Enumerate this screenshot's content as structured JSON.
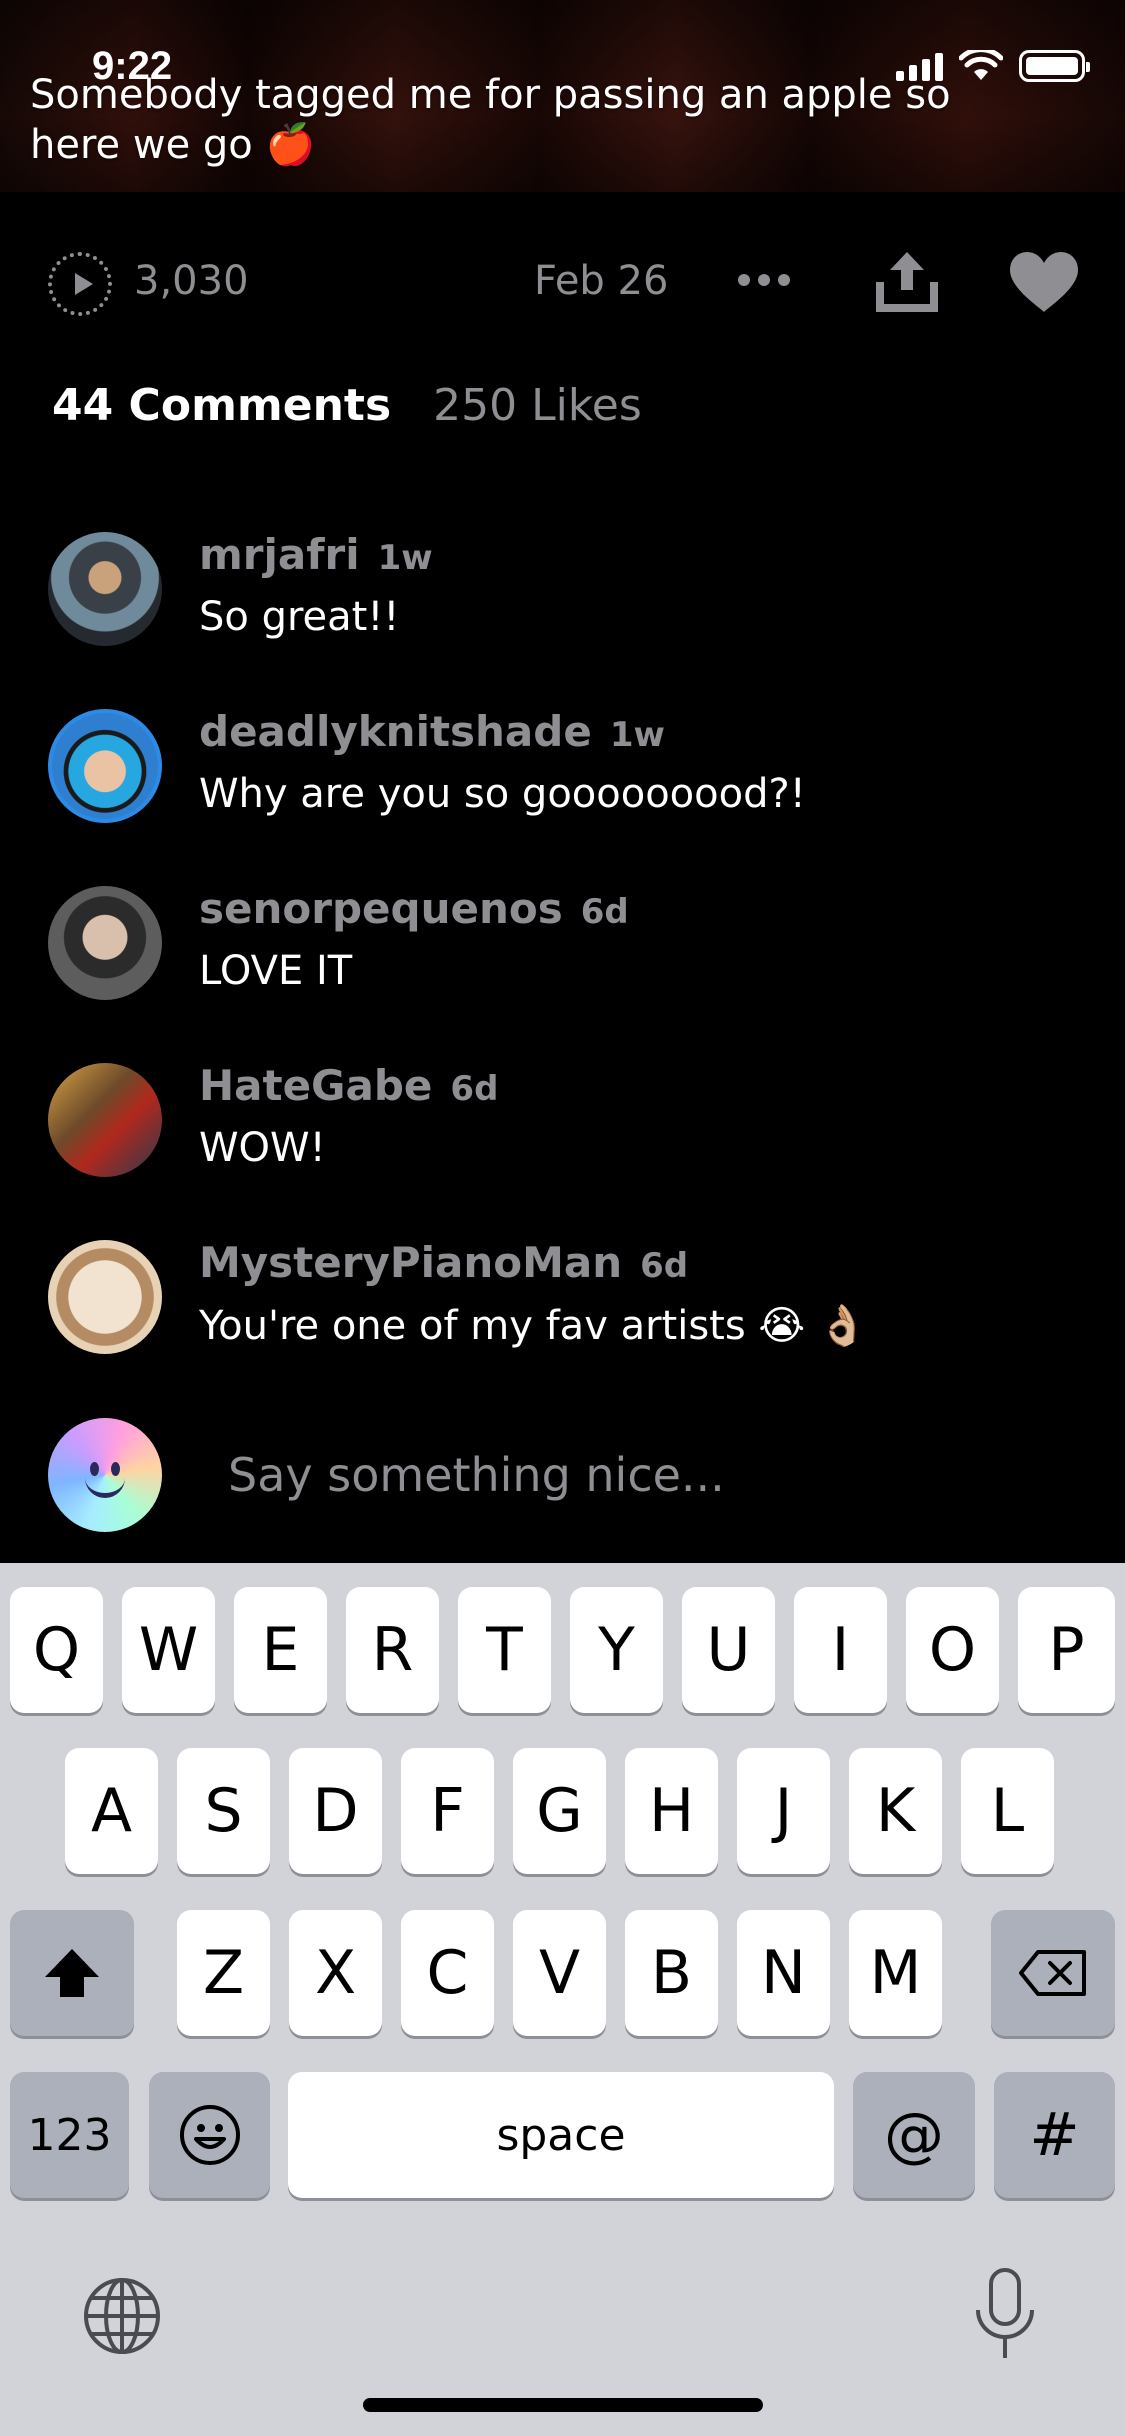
{
  "status_bar": {
    "time": "9:22"
  },
  "video": {
    "caption": "Somebody tagged me for passing an apple so here we go 🍎"
  },
  "meta": {
    "plays": "3,030",
    "date": "Feb 26"
  },
  "tabs": {
    "comments": "44 Comments",
    "likes": "250 Likes"
  },
  "comments": [
    {
      "user": "mrjafri",
      "age": "1w",
      "text": "So great!!"
    },
    {
      "user": "deadlyknitshade",
      "age": "1w",
      "text": "Why are you so gooooooood?!"
    },
    {
      "user": "senorpequenos",
      "age": "6d",
      "text": "LOVE IT"
    },
    {
      "user": "HateGabe",
      "age": "6d",
      "text": "WOW!"
    },
    {
      "user": "MysteryPianoMan",
      "age": "6d",
      "text": "You're one of my fav artists 😭 👌🏼"
    }
  ],
  "comment_input": {
    "placeholder": "Say something nice..."
  },
  "keyboard": {
    "row1": [
      "Q",
      "W",
      "E",
      "R",
      "T",
      "Y",
      "U",
      "I",
      "O",
      "P"
    ],
    "row2": [
      "A",
      "S",
      "D",
      "F",
      "G",
      "H",
      "J",
      "K",
      "L"
    ],
    "row3": [
      "Z",
      "X",
      "C",
      "V",
      "B",
      "N",
      "M"
    ],
    "numbers_label": "123",
    "space_label": "space",
    "at_label": "@",
    "hash_label": "#"
  },
  "icons": {
    "play": "play-count-icon",
    "more": "more-icon",
    "share": "share-icon",
    "like": "heart-icon",
    "shift": "shift-icon",
    "backspace": "backspace-icon",
    "emoji": "emoji-icon",
    "globe": "globe-icon",
    "mic": "microphone-icon"
  },
  "colors": {
    "muted": "#8e8e93",
    "keyboard_bg": "#d1d3d9",
    "special_key": "#abb0bb"
  }
}
